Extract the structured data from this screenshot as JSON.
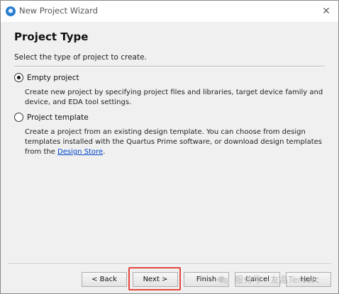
{
  "window": {
    "title": "New Project Wizard",
    "close_glyph": "✕"
  },
  "page": {
    "title": "Project Type",
    "subtitle": "Select the type of project to create."
  },
  "options": [
    {
      "label": "Empty project",
      "checked": true,
      "description": "Create new project by specifying project files and libraries, target device family and device, and EDA tool settings."
    },
    {
      "label": "Project template",
      "checked": false,
      "description_before_link": "Create a project from an existing design template. You can choose from design templates installed with the Quartus Prime software, or download design templates from the ",
      "link_text": "Design Store",
      "description_after_link": "."
    }
  ],
  "buttons": {
    "back": "< Back",
    "next": "Next >",
    "finish": "Finish",
    "cancel": "Cancel",
    "help": "Help"
  },
  "watermark": "服务号 · 友晶Terasic",
  "colors": {
    "highlight": "#e6463c",
    "link": "#0045c9"
  }
}
